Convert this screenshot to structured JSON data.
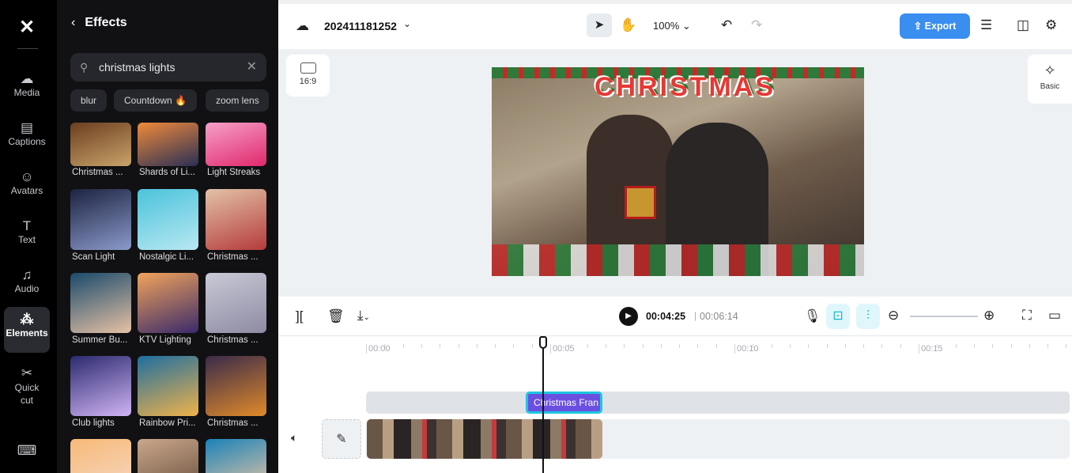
{
  "rail": {
    "items": [
      {
        "label": "Media",
        "icon": "cloud-upload-icon"
      },
      {
        "label": "Captions",
        "icon": "captions-icon"
      },
      {
        "label": "Avatars",
        "icon": "avatar-icon"
      },
      {
        "label": "Text",
        "icon": "text-icon"
      },
      {
        "label": "Audio",
        "icon": "music-icon"
      },
      {
        "label": "Elements",
        "icon": "elements-icon",
        "active": true
      },
      {
        "label": "Quick cut",
        "icon": "quick-cut-icon"
      }
    ]
  },
  "panel": {
    "title": "Effects",
    "search_value": "christmas lights",
    "chips": [
      "blur",
      "Countdown",
      "zoom lens"
    ],
    "effects": [
      "Christmas ...",
      "Shards of Li...",
      "Light Streaks",
      "Scan Light",
      "Nostalgic Li...",
      "Christmas ...",
      "Summer Bu...",
      "KTV Lighting",
      "Christmas ...",
      "Club lights",
      "Rainbow Pri...",
      "Christmas ...",
      "",
      "",
      ""
    ]
  },
  "topbar": {
    "project": "202411181252",
    "zoom": "100%",
    "export": "Export"
  },
  "canvas": {
    "ratio": "16:9",
    "basic": "Basic",
    "overlay_text": "CHRISTMAS"
  },
  "timeline": {
    "current": "00:04:25",
    "total": "00:06:14",
    "ruler": [
      "00:00",
      "00:05",
      "00:10",
      "00:15"
    ],
    "clip_label": "Christmas Fran"
  },
  "colors": {
    "accent": "#3a8ef0",
    "clip": "#6b4fe0",
    "clip_border": "#1ec6e0"
  }
}
